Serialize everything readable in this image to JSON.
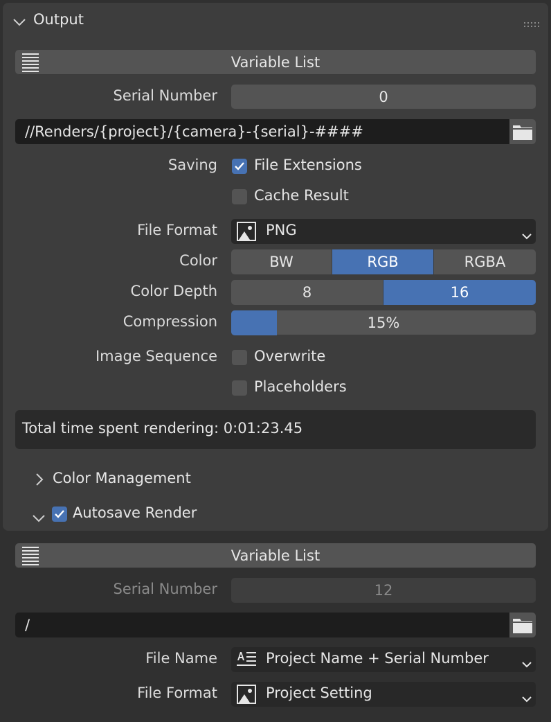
{
  "output": {
    "header": {
      "title": "Output"
    },
    "variable_list_label": "Variable List",
    "serial_number": {
      "label": "Serial Number",
      "value": "0"
    },
    "path": {
      "value": "//Renders/{project}/{camera}-{serial}-####"
    },
    "saving": {
      "label": "Saving",
      "file_extensions": {
        "label": "File Extensions",
        "checked": true
      },
      "cache_result": {
        "label": "Cache Result",
        "checked": false
      }
    },
    "file_format": {
      "label": "File Format",
      "value": "PNG",
      "icon": "image-icon"
    },
    "color": {
      "label": "Color",
      "options": [
        "BW",
        "RGB",
        "RGBA"
      ],
      "selected": "RGB"
    },
    "color_depth": {
      "label": "Color Depth",
      "options": [
        "8",
        "16"
      ],
      "selected": "16"
    },
    "compression": {
      "label": "Compression",
      "value": "15%",
      "fraction": 0.15
    },
    "image_sequence": {
      "label": "Image Sequence",
      "overwrite": {
        "label": "Overwrite",
        "checked": false
      },
      "placeholders": {
        "label": "Placeholders",
        "checked": false
      }
    },
    "info": {
      "text": "Total time spent rendering: 0:01:23.45"
    }
  },
  "color_management": {
    "title": "Color Management",
    "expanded": false
  },
  "autosave": {
    "title": "Autosave Render",
    "enabled": true,
    "expanded": true,
    "variable_list_label": "Variable List",
    "serial_number": {
      "label": "Serial Number",
      "value": "12",
      "disabled": true
    },
    "path": {
      "value": "/"
    },
    "file_name": {
      "label": "File Name",
      "value": "Project Name + Serial Number",
      "icon": "text-align-icon"
    },
    "file_format": {
      "label": "File Format",
      "value": "Project Setting",
      "icon": "image-icon"
    }
  },
  "colors": {
    "accent": "#4772b3",
    "panel_bg": "#303030",
    "subpanel_bg": "#3d3d3d",
    "button": "#545454",
    "field": "#1d1d1d"
  }
}
